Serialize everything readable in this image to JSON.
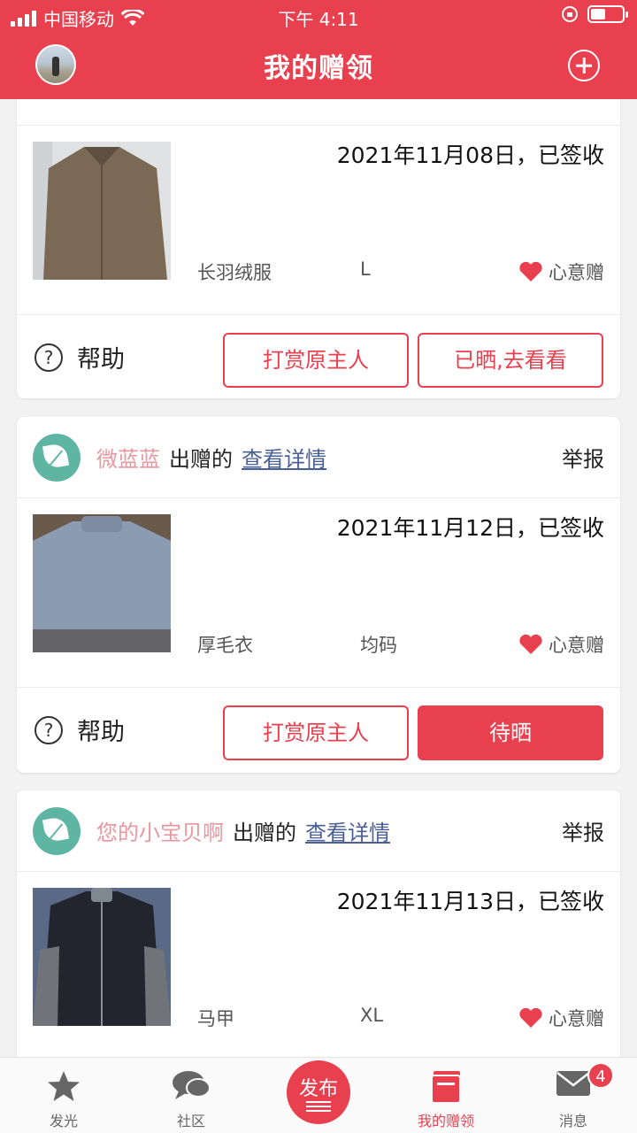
{
  "status_bar": {
    "carrier": "中国移动",
    "time": "下午 4:11"
  },
  "header": {
    "title": "我的赠领"
  },
  "cards": [
    {
      "date": "2021年11月08日，已签收",
      "item": "长羽绒服",
      "size": "L",
      "gift_type": "心意赠",
      "help": "帮助",
      "tip_btn": "打赏原主人",
      "show_btn": "已晒,去看看",
      "thumb_color": "#7a6a55"
    },
    {
      "donor": "微蓝蓝",
      "gave": "出赠的",
      "detail": "查看详情",
      "report": "举报",
      "date": "2021年11月12日，已签收",
      "item": "厚毛衣",
      "size": "均码",
      "gift_type": "心意赠",
      "help": "帮助",
      "tip_btn": "打赏原主人",
      "show_btn": "待晒",
      "thumb_color": "#8b9bb2"
    },
    {
      "donor": "您的小宝贝啊",
      "gave": "出赠的",
      "detail": "查看详情",
      "report": "举报",
      "date": "2021年11月13日，已签收",
      "item": "马甲",
      "size": "XL",
      "gift_type": "心意赠",
      "thumb_color": "#22252d"
    }
  ],
  "tabbar": {
    "items": [
      {
        "label": "发光",
        "icon": "star-icon"
      },
      {
        "label": "社区",
        "icon": "chat-icon"
      },
      {
        "label": "发布",
        "icon": "publish-icon"
      },
      {
        "label": "我的赠领",
        "icon": "gift-box-icon"
      },
      {
        "label": "消息",
        "icon": "mail-icon"
      }
    ],
    "message_badge": "4"
  },
  "colors": {
    "brand": "#e8404f",
    "link": "#4a5f94",
    "donor": "#e8979f"
  }
}
